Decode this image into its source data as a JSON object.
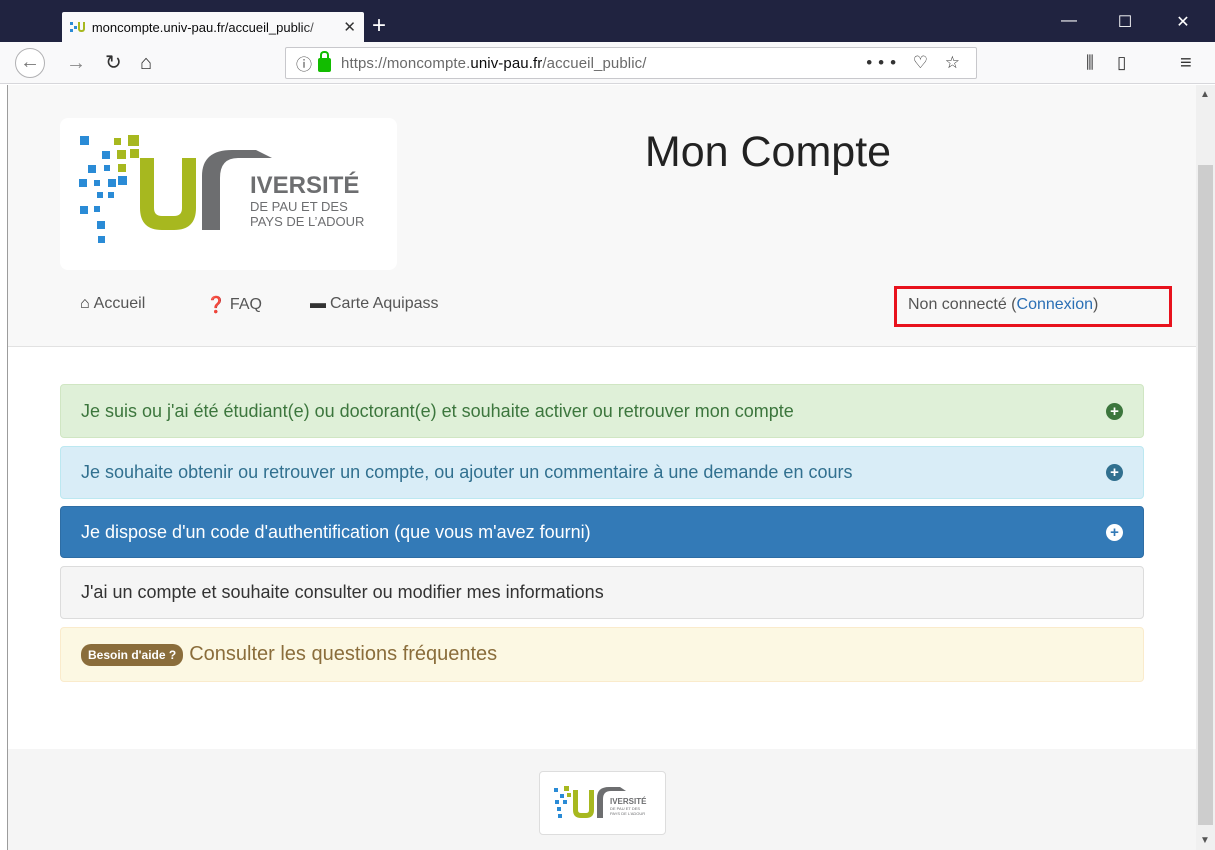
{
  "browser": {
    "tab_title": "moncompte.univ-pau.fr/accueil_public/",
    "tab_close": "✕",
    "new_tab": "+",
    "url_prefix": "https://moncompte.",
    "url_domain": "univ-pau.fr",
    "url_path": "/accueil_public/",
    "url_actions": "••• ♡ ☆",
    "win_min": "—",
    "win_max": "☐",
    "win_close": "✕"
  },
  "header": {
    "title": "Mon Compte",
    "logo": {
      "line1": "IVERSITÉ",
      "line2": "DE PAU ET DES",
      "line3": "PAYS DE L’ADOUR"
    }
  },
  "menu": [
    {
      "icon": "home-icon",
      "label": "Accueil"
    },
    {
      "icon": "question-circle-icon",
      "label": "FAQ"
    },
    {
      "icon": "card-icon",
      "label": "Carte Aquipass"
    }
  ],
  "status": {
    "text": "Non connecté (",
    "link": "Connexion",
    "close": ")"
  },
  "panels": [
    {
      "label": "Je suis ou j'ai été étudiant(e) ou doctorant(e) et souhaite activer ou retrouver mon compte",
      "icon": "plus-circle-icon"
    },
    {
      "label": "Je souhaite obtenir ou retrouver un compte, ou ajouter un commentaire à une demande en cours",
      "icon": "plus-circle-icon"
    },
    {
      "label": "Je dispose d'un code d'authentification (que vous m'avez fourni)",
      "icon": "plus-circle-icon"
    },
    {
      "label": "J'ai un compte et souhaite consulter ou modifier mes informations"
    }
  ],
  "help": {
    "badge": "Besoin d'aide ?",
    "link": "Consulter les questions fréquentes"
  },
  "colors": {
    "brand_blue": "#2a8bd6",
    "brand_green": "#a7b81f",
    "brand_gray": "#6d6e70",
    "alert_red": "#e8121d"
  }
}
